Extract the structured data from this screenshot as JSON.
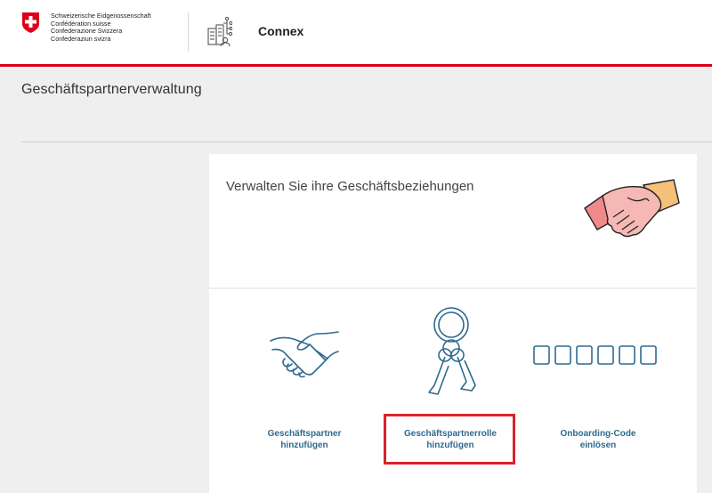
{
  "header": {
    "federal_lines": [
      "Schweizerische Eidgenossenschaft",
      "Confédération suisse",
      "Confederazione Svizzera",
      "Confederaziun svizra"
    ],
    "app_name": "Connex",
    "accent_color": "#dc0018"
  },
  "page": {
    "title": "Geschäftspartnerverwaltung"
  },
  "card": {
    "heading": "Verwalten Sie ihre Geschäftsbeziehungen",
    "actions": [
      {
        "icon": "handshake-icon",
        "label_line1": "Geschäftspartner",
        "label_line2": "hinzufügen"
      },
      {
        "icon": "keys-icon",
        "label_line1": "Geschäftspartnerrolle",
        "label_line2": "hinzufügen",
        "highlighted": true
      },
      {
        "icon": "code-boxes-icon",
        "label_line1": "Onboarding-Code",
        "label_line2": "einlösen"
      }
    ],
    "link_color": "#2f6a8f"
  }
}
